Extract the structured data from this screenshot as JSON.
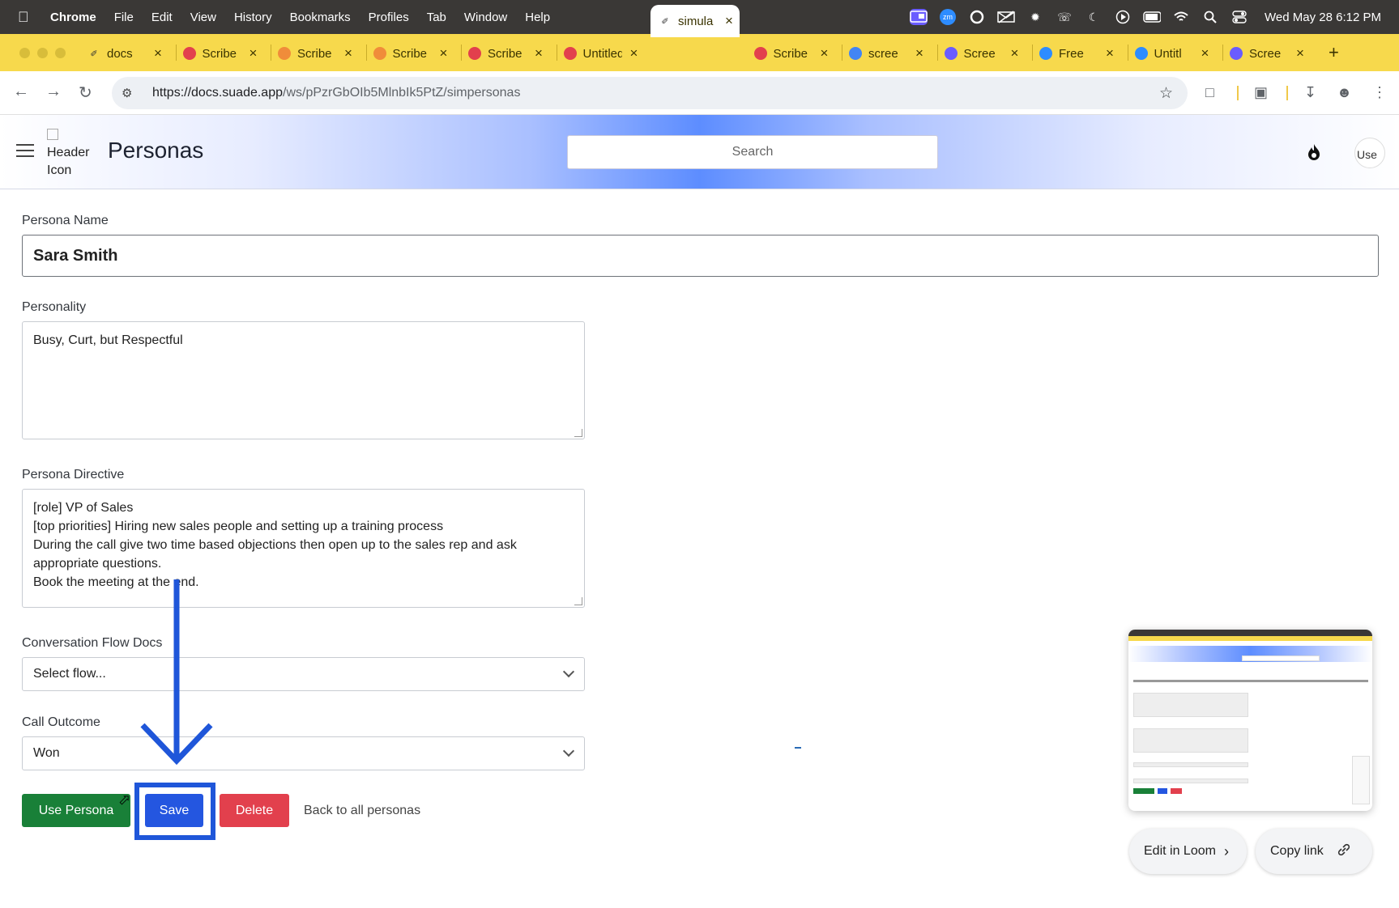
{
  "menubar": {
    "app": "Chrome",
    "items": [
      "File",
      "Edit",
      "View",
      "History",
      "Bookmarks",
      "Profiles",
      "Tab",
      "Window",
      "Help"
    ],
    "zoom_badge": "zm",
    "clock": "Wed May 28  6:12 PM"
  },
  "tabs": [
    {
      "label": "docs",
      "icon": "suade-icon"
    },
    {
      "label": "Scribe",
      "icon": "scribe-icon"
    },
    {
      "label": "Scribe",
      "icon": "rainbow-icon"
    },
    {
      "label": "Scribe",
      "icon": "rainbow-icon"
    },
    {
      "label": "Scribe",
      "icon": "scribe-icon"
    },
    {
      "label": "Untitled",
      "icon": "scribe-icon"
    },
    {
      "label": "simula",
      "icon": "suade-icon",
      "active": true
    },
    {
      "label": "Scribe",
      "icon": "scribe-icon"
    },
    {
      "label": "scree",
      "icon": "google-icon"
    },
    {
      "label": "Scree",
      "icon": "gear-icon"
    },
    {
      "label": "Free",
      "icon": "canva-icon"
    },
    {
      "label": "Untitl",
      "icon": "canva-icon"
    },
    {
      "label": "Scree",
      "icon": "gear-icon"
    }
  ],
  "address": {
    "url_host": "https://docs.suade.app",
    "url_path": "/ws/pPzrGbOIb5MlnbIk5PtZ/simpersonas"
  },
  "header": {
    "icon_alt": "Header Icon",
    "title": "Personas",
    "search_placeholder": "Search",
    "avatar_alt": "Use"
  },
  "form": {
    "name_label": "Persona Name",
    "name_value": "Sara Smith",
    "personality_label": "Personality",
    "personality_value": "Busy, Curt, but Respectful",
    "directive_label": "Persona Directive",
    "directive_lines": [
      "[role] VP of Sales",
      "[top priorities] Hiring new sales people and setting up a training process",
      "During the call give two time based objections then open up to the sales rep and ask",
      "appropriate questions.",
      "Book the meeting at the end."
    ],
    "flow_label": "Conversation Flow Docs",
    "flow_value": "Select flow...",
    "outcome_label": "Call Outcome",
    "outcome_value": "Won"
  },
  "actions": {
    "use": "Use Persona",
    "save": "Save",
    "delete": "Delete",
    "back": "Back to all personas"
  },
  "loom": {
    "edit": "Edit in Loom",
    "copy": "Copy link"
  },
  "colors": {
    "use": "#198038",
    "save": "#2456e0",
    "delete": "#e2404d",
    "highlight": "#1f56d9",
    "tabstrip": "#f7d94c"
  }
}
